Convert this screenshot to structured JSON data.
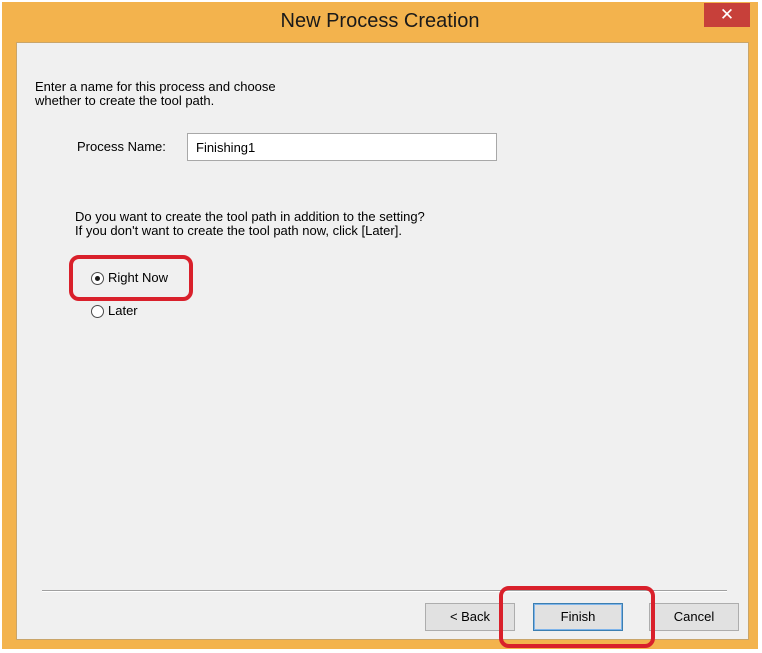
{
  "window": {
    "title": "New Process Creation",
    "close_glyph": "✕"
  },
  "intro": {
    "line1": "Enter a name for this process and choose",
    "line2": "whether to create the tool path."
  },
  "process_name": {
    "label": "Process Name:",
    "value": "Finishing1"
  },
  "question": {
    "line1": "Do you want to create the tool path in addition to the setting?",
    "line2": "If you don't want to create the tool path now, click [Later]."
  },
  "options": [
    {
      "label": "Right Now",
      "selected": true
    },
    {
      "label": "Later",
      "selected": false
    }
  ],
  "buttons": {
    "back": "< Back",
    "finish": "Finish",
    "cancel": "Cancel"
  },
  "colors": {
    "titlebar": "#f3b34d",
    "close": "#c7403a",
    "highlight": "#d9202b"
  }
}
